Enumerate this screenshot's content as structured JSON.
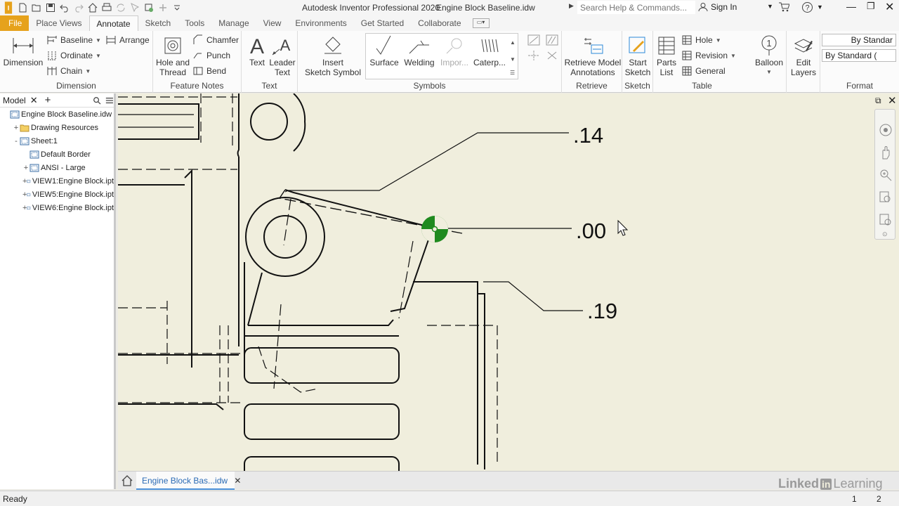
{
  "title_bar": {
    "app_title": "Autodesk Inventor Professional 2020",
    "doc_title": "Engine Block Baseline.idw",
    "search_placeholder": "Search Help & Commands...",
    "sign_in": "Sign In",
    "quick_access_icons": [
      "inventor-logo-icon",
      "new-icon",
      "open-icon",
      "save-icon",
      "undo-icon",
      "redo-icon",
      "home-icon",
      "print-icon",
      "update-icon",
      "select-icon",
      "appearance-icon",
      "add-icon",
      "qat-customize-icon"
    ]
  },
  "tabs": [
    "File",
    "Place Views",
    "Annotate",
    "Sketch",
    "Tools",
    "Manage",
    "View",
    "Environments",
    "Get Started",
    "Collaborate"
  ],
  "active_tab": "Annotate",
  "ribbon": {
    "dimension": {
      "title": "Dimension",
      "dimension_label": "Dimension",
      "baseline_label": "Baseline",
      "ordinate_label": "Ordinate",
      "chain_label": "Chain",
      "arrange_label": "Arrange"
    },
    "feature_notes": {
      "title": "Feature Notes",
      "hole_label": "Hole and",
      "thread_label": "Thread",
      "chamfer_label": "Chamfer",
      "punch_label": "Punch",
      "bend_label": "Bend"
    },
    "text": {
      "title": "Text",
      "text_label": "Text",
      "leader_label": "Leader",
      "leader_text_label": "Text"
    },
    "symbols": {
      "title": "Symbols",
      "insert_label": "Insert",
      "sketch_symbol_label": "Sketch Symbol",
      "surface_label": "Surface",
      "welding_label": "Welding",
      "import_label": "Impor...",
      "caterpillar_label": "Caterp..."
    },
    "retrieve": {
      "title": "Retrieve",
      "label1": "Retrieve Model",
      "label2": "Annotations"
    },
    "sketch": {
      "title": "Sketch",
      "label1": "Start",
      "label2": "Sketch"
    },
    "table": {
      "title": "Table",
      "parts_label1": "Parts",
      "parts_label2": "List",
      "hole_label": "Hole",
      "revision_label": "Revision",
      "general_label": "General"
    },
    "balloon_label": "Balloon",
    "edit_layers_label1": "Edit",
    "edit_layers_label2": "Layers",
    "format": {
      "title": "Format",
      "style1": "By Standar",
      "style2": "By Standard ("
    }
  },
  "browser": {
    "tab_label": "Model",
    "items": [
      {
        "label": "Engine Block Baseline.idw",
        "level": 0,
        "expander": ""
      },
      {
        "label": "Drawing Resources",
        "level": 1,
        "expander": "+"
      },
      {
        "label": "Sheet:1",
        "level": 1,
        "expander": "-"
      },
      {
        "label": "Default Border",
        "level": 2,
        "expander": ""
      },
      {
        "label": "ANSI - Large",
        "level": 2,
        "expander": "+"
      },
      {
        "label": "VIEW1:Engine Block.ipt",
        "level": 2,
        "expander": "+"
      },
      {
        "label": "VIEW5:Engine Block.ipt",
        "level": 2,
        "expander": "+"
      },
      {
        "label": "VIEW6:Engine Block.ipt",
        "level": 2,
        "expander": "+"
      }
    ]
  },
  "drawing": {
    "dim_labels": [
      ".14",
      ".00",
      ".19"
    ]
  },
  "doc_tab_label": "Engine Block Bas...idw",
  "status": {
    "text": "Ready",
    "page1": "1",
    "page2": "2"
  },
  "watermark_brand": "Linked",
  "watermark_brand_box": "in",
  "watermark_brand_tail": "Learning",
  "colors": {
    "file_tab": "#e6a21c",
    "canvas_bg": "#f0eedd",
    "selection_green": "#1f8a1f",
    "accent_blue": "#4a90d9"
  }
}
